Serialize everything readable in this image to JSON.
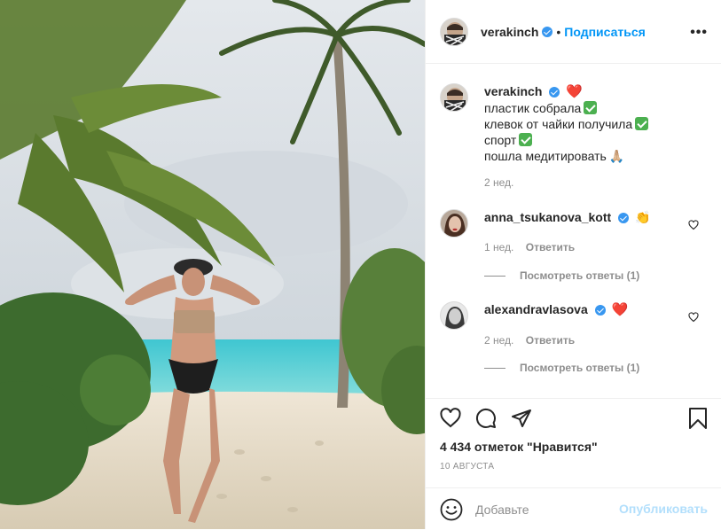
{
  "post": {
    "author": "verakinch",
    "follow_label": "Подписаться",
    "separator": "•",
    "more_label": "•••",
    "verified": true
  },
  "caption": {
    "username": "verakinch",
    "lines": [
      "пластик собрала",
      "клевок от чайки получила",
      "спорт",
      "пошла медитировать"
    ],
    "emojis": {
      "heart": "❤️",
      "pray": "🙏🏼"
    },
    "time": "2 нед."
  },
  "comments": [
    {
      "username": "anna_tsukanova_kott",
      "text": "👏",
      "time": "1 нед.",
      "reply_label": "Ответить",
      "view_replies": "Посмотреть ответы (1)"
    },
    {
      "username": "alexandravlasova",
      "text": "❤️",
      "time": "2 нед.",
      "reply_label": "Ответить",
      "view_replies": "Посмотреть ответы (1)"
    }
  ],
  "actions": {
    "icons": [
      "heart-icon",
      "comment-icon",
      "share-icon",
      "bookmark-icon"
    ],
    "likes": "4 434 отметок \"Нравится\"",
    "date": "10 АВГУСТА"
  },
  "add_comment": {
    "placeholder": "Добавьте",
    "publish_label": "Опубликовать"
  },
  "colors": {
    "link": "#0095f6",
    "verified": "#3897f0",
    "muted": "#8e8e8e",
    "publish_disabled": "#b2dffc"
  }
}
